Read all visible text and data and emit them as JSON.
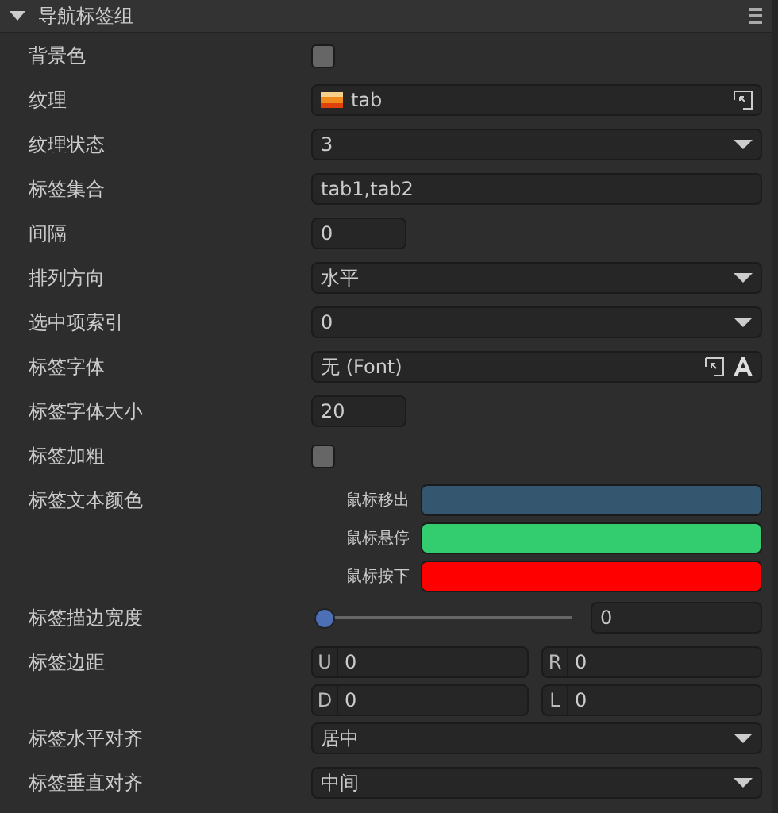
{
  "panel": {
    "title": "导航标签组",
    "expanded": true
  },
  "rows": [
    {
      "kind": "checkbox",
      "label": "背景色",
      "checked": false
    },
    {
      "kind": "asset",
      "label": "纹理",
      "value": "tab"
    },
    {
      "kind": "select",
      "label": "纹理状态",
      "value": "3"
    },
    {
      "kind": "text",
      "label": "标签集合",
      "value": "tab1,tab2"
    },
    {
      "kind": "number",
      "label": "间隔",
      "value": "0"
    },
    {
      "kind": "select",
      "label": "排列方向",
      "value": "水平"
    },
    {
      "kind": "select",
      "label": "选中项索引",
      "value": "0"
    },
    {
      "kind": "font",
      "label": "标签字体",
      "value": "无 (Font)"
    },
    {
      "kind": "number",
      "label": "标签字体大小",
      "value": "20"
    },
    {
      "kind": "checkbox",
      "label": "标签加粗",
      "checked": false
    },
    {
      "kind": "colors",
      "label": "标签文本颜色",
      "colors": [
        {
          "label": "鼠标移出",
          "color": "#34566f"
        },
        {
          "label": "鼠标悬停",
          "color": "#33cc6e"
        },
        {
          "label": "鼠标按下",
          "color": "#ff0000"
        }
      ]
    },
    {
      "kind": "slider",
      "label": "标签描边宽度",
      "level": 0,
      "value": "0"
    },
    {
      "kind": "padding",
      "label": "标签边距",
      "fields": [
        {
          "prefix": "U",
          "value": "0"
        },
        {
          "prefix": "R",
          "value": "0"
        },
        {
          "prefix": "D",
          "value": "0"
        },
        {
          "prefix": "L",
          "value": "0"
        }
      ]
    },
    {
      "kind": "select",
      "label": "标签水平对齐",
      "value": "居中"
    },
    {
      "kind": "select",
      "label": "标签垂直对齐",
      "value": "中间"
    }
  ]
}
